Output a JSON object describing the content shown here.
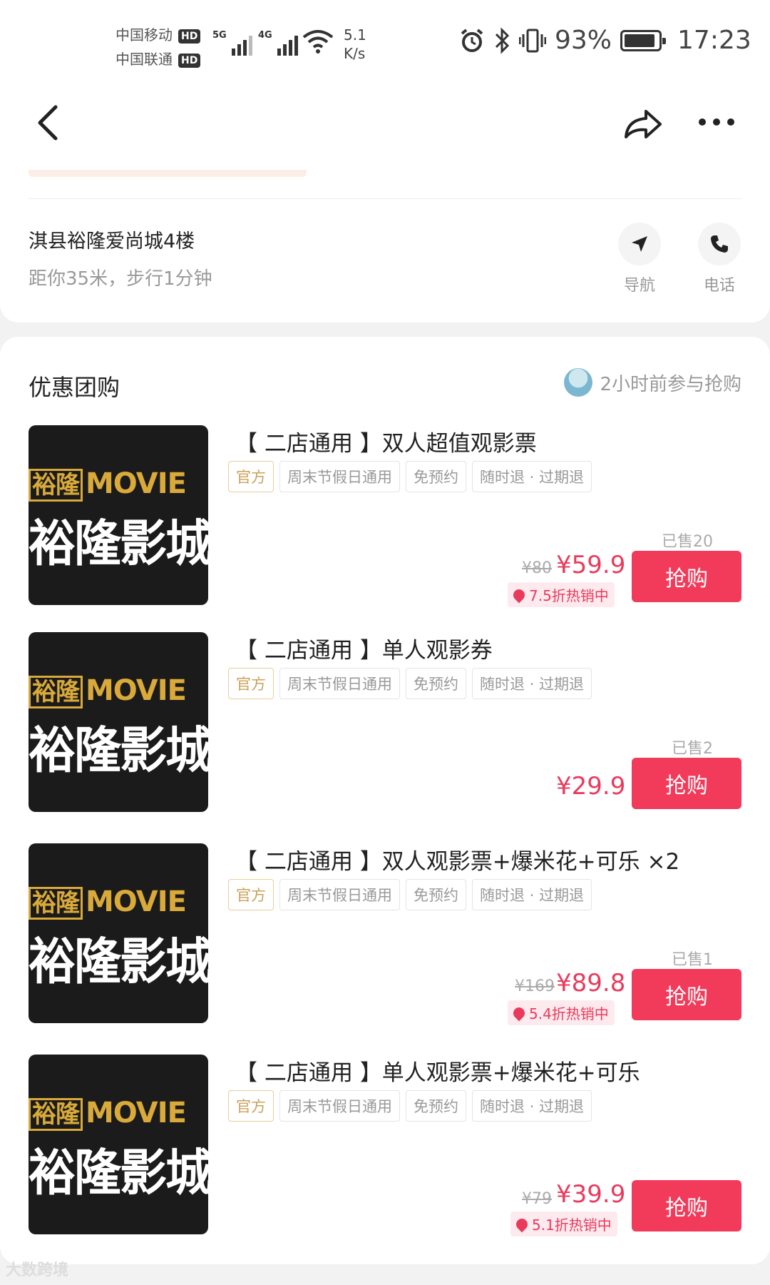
{
  "status_bar": {
    "carrier1": "中国移动",
    "carrier2": "中国联通",
    "hd": "HD",
    "gen1": "5G",
    "gen2": "4G",
    "speed_value": "5.1",
    "speed_unit": "K/s",
    "battery": "93%",
    "time": "17:23"
  },
  "nav": {
    "back_icon": "chevron-left-icon",
    "share_icon": "share-arrow-icon",
    "more_icon": "more-dots-icon"
  },
  "address": {
    "line": "淇县裕隆爱尚城4楼",
    "distance": "距你35米，步行1分钟",
    "navigate_label": "导航",
    "phone_label": "电话"
  },
  "deals": {
    "title": "优惠团购",
    "recent_activity": "2小时前参与抢购",
    "tags": [
      "官方",
      "周末节假日通用",
      "免预约",
      "随时退 · 过期退"
    ],
    "thumb_brand_box": "裕隆",
    "thumb_brand_word": "MOVIE",
    "thumb_cn": "裕隆影城",
    "buy_label": "抢购",
    "items": [
      {
        "name": "【 二店通用 】双人超值观影票",
        "sold": "已售20",
        "original_price": "¥80",
        "price": "¥59.9",
        "discount": "7.5折热销中"
      },
      {
        "name": "【 二店通用 】单人观影券",
        "sold": "已售2",
        "original_price": "",
        "price": "¥29.9",
        "discount": ""
      },
      {
        "name": "【 二店通用 】双人观影票+爆米花+可乐 ×2",
        "sold": "已售1",
        "original_price": "¥169",
        "price": "¥89.8",
        "discount": "5.4折热销中"
      },
      {
        "name": "【 二店通用 】单人观影票+爆米花+可乐",
        "sold": "",
        "original_price": "¥79",
        "price": "¥39.9",
        "discount": "5.1折热销中"
      }
    ]
  },
  "watermark": "大数跨境",
  "colors": {
    "accent": "#f23a5a",
    "price": "#ea3a5c",
    "official_tag": "#c9a15a"
  }
}
